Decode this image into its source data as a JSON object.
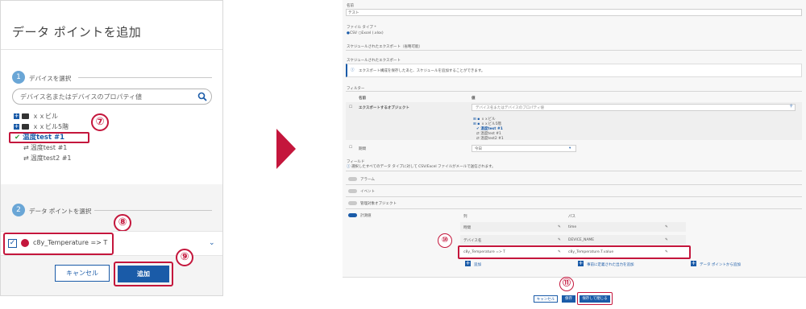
{
  "dialog": {
    "title": "データ ポイントを追加",
    "step1": {
      "number": "1",
      "label": "デバイスを選択"
    },
    "search_placeholder": "デバイス名またはデバイスのプロパティ値",
    "tree": [
      {
        "label": "ｘｘビル"
      },
      {
        "label": "ｘｘビル5階"
      }
    ],
    "selected_device": "温度test #1",
    "devices": [
      "温度test #1",
      "温度test2 #1"
    ],
    "step2": {
      "number": "2",
      "label": "データ ポイントを選択"
    },
    "datapoint_label": "c8y_Temperature => T",
    "cancel_label": "キャンセル",
    "add_label": "追加",
    "callouts": {
      "c7": "⑦",
      "c8": "⑧",
      "c9": "⑨"
    },
    "colors": {
      "accent": "#1a5ba8",
      "highlight": "#c4163c",
      "step": "#6aa6d6"
    }
  },
  "right": {
    "name_label": "名前",
    "name_value": "テスト",
    "filetype_label": "ファイル タイプ *",
    "filetype_csv": "CSV",
    "filetype_excel": "Excel (.xlsx)",
    "schedule_header": "スケジュールされたエクスポート（省略可能）",
    "schedule_sub": "スケジュールされたエクスポート",
    "info_text": "エクスポート構成を保存したあと、スケジュールを追加することができます。",
    "filter_header": "フィルター",
    "col_name": "名前",
    "col_value": "値",
    "export_objects_label": "エクスポートするオブジェクト",
    "export_search_placeholder": "デバイス名またはデバイスのプロパティ値",
    "tree": [
      "ｘｘビル",
      "ｘｘビル5階",
      "温度test #1",
      "温度test #1",
      "温度test2 #1"
    ],
    "period_label": "期間",
    "period_value": "今日",
    "fields_header": "フィールド",
    "fields_info": "選択したすべてのデータ タイプに対して CSV/Excel ファイルがメールで送信されます。",
    "toggles": [
      {
        "label": "アラーム",
        "on": false
      },
      {
        "label": "イベント",
        "on": false
      },
      {
        "label": "管理対象オブジェクト",
        "on": false
      },
      {
        "label": "計測値",
        "on": true
      }
    ],
    "col_column": "列",
    "col_path": "パス",
    "rows": [
      {
        "column": "時間",
        "path": "time"
      },
      {
        "column": "デバイス名",
        "path": "DEVICE_NAME"
      },
      {
        "column": "c8y_Temperature => T",
        "path": "c8y_Temperature.T.value"
      }
    ],
    "add_btn": "追加",
    "add_std": "事前に定義された出力を追加",
    "add_dp": "データ ポイントから追加",
    "cancel_btn": "キャンセル",
    "save_btn": "保存",
    "save_close_btn": "保存して閉じる",
    "callouts": {
      "c10": "⑩",
      "c11": "⑪"
    }
  }
}
